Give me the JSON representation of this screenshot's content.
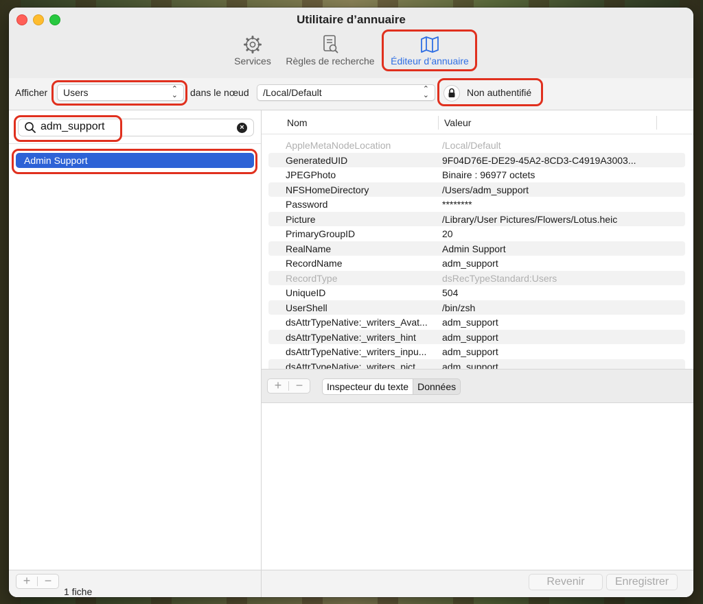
{
  "window": {
    "title": "Utilitaire d’annuaire"
  },
  "toolbar": {
    "services_label": "Services",
    "rules_label": "Règles de recherche",
    "editor_label": "Éditeur d’annuaire"
  },
  "filter": {
    "show_label": "Afficher",
    "record_type": "Users",
    "node_label": "dans le nœud",
    "node_value": "/Local/Default",
    "auth_status": "Non authentifié"
  },
  "search": {
    "value": "adm_support"
  },
  "records": {
    "items": [
      "Admin Support"
    ],
    "count_label": "1 fiche"
  },
  "table": {
    "col_name": "Nom",
    "col_value": "Valeur",
    "rows": [
      {
        "name": "AppleMetaNodeLocation",
        "value": "/Local/Default"
      },
      {
        "name": "GeneratedUID",
        "value": "9F04D76E-DE29-45A2-8CD3-C4919A3003..."
      },
      {
        "name": "JPEGPhoto",
        "value": "Binaire : 96977 octets"
      },
      {
        "name": "NFSHomeDirectory",
        "value": "/Users/adm_support"
      },
      {
        "name": "Password",
        "value": "********"
      },
      {
        "name": "Picture",
        "value": "/Library/User Pictures/Flowers/Lotus.heic"
      },
      {
        "name": "PrimaryGroupID",
        "value": "20"
      },
      {
        "name": "RealName",
        "value": "Admin Support"
      },
      {
        "name": "RecordName",
        "value": "adm_support"
      },
      {
        "name": "RecordType",
        "value": "dsRecTypeStandard:Users"
      },
      {
        "name": "UniqueID",
        "value": "504"
      },
      {
        "name": "UserShell",
        "value": "/bin/zsh"
      },
      {
        "name": "dsAttrTypeNative:_writers_Avat...",
        "value": "adm_support"
      },
      {
        "name": "dsAttrTypeNative:_writers_hint",
        "value": "adm_support"
      },
      {
        "name": "dsAttrTypeNative:_writers_inpu...",
        "value": "adm_support"
      },
      {
        "name": "dsAttrTypeNative:_writers_pict...",
        "value": "adm_support"
      }
    ]
  },
  "inspector": {
    "text_tab": "Inspecteur du texte",
    "data_tab": "Données"
  },
  "actions": {
    "revert": "Revenir",
    "save": "Enregistrer"
  },
  "colors": {
    "accent": "#2d62d6",
    "highlight": "#e0301e"
  }
}
